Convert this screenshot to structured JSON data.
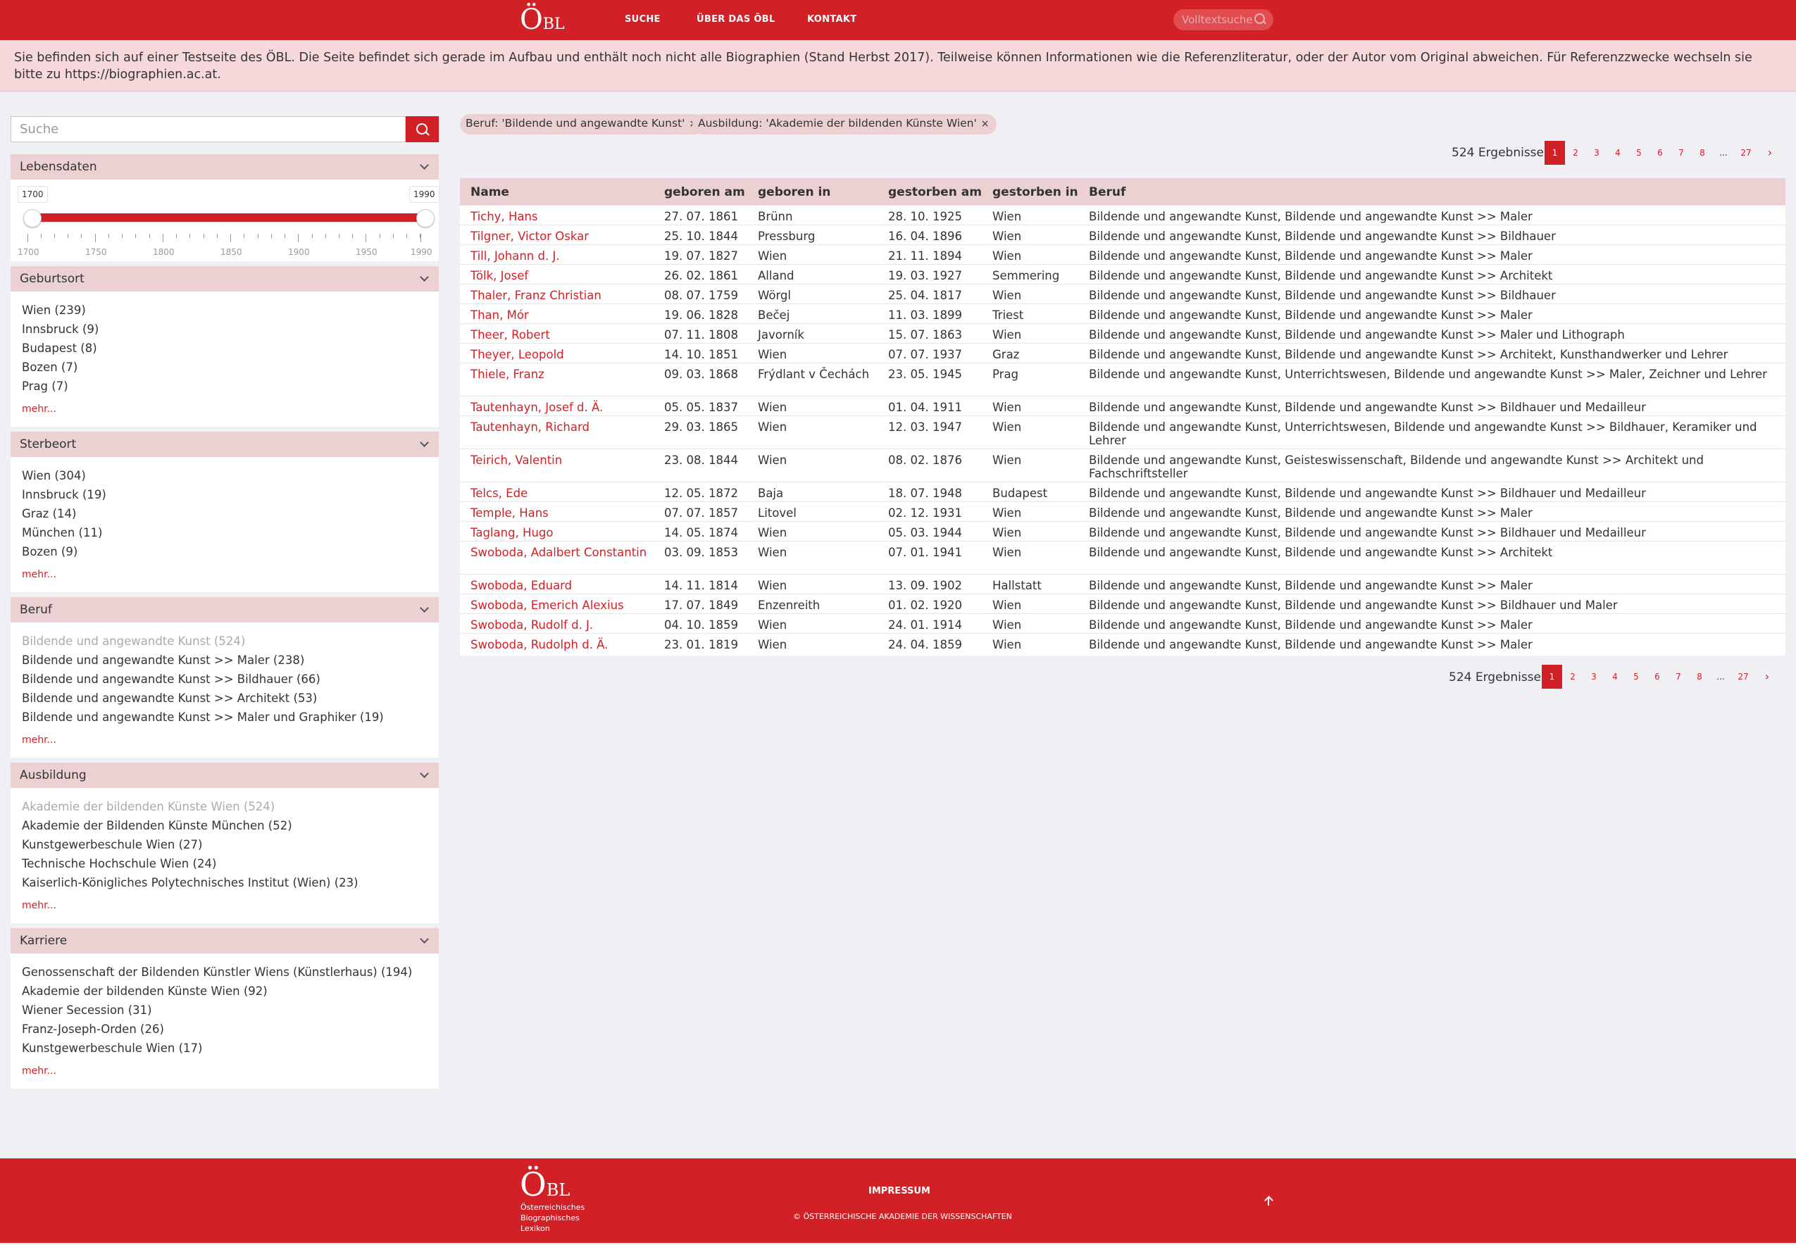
{
  "header": {
    "logo_big": "Ö",
    "logo_small": "BL",
    "nav": [
      "SUCHE",
      "ÜBER DAS ÖBL",
      "KONTAKT"
    ],
    "fulltext_placeholder": "Volltextsuche"
  },
  "notice": "Sie befinden sich auf einer Testseite des ÖBL. Die Seite befindet sich gerade im Aufbau und enthält noch nicht alle Biographien (Stand Herbst 2017). Teilweise können Informationen wie die Referenzliteratur, oder der Autor vom Original abweichen. Für Referenzzwecke wechseln sie bitte zu https://biographien.ac.at.",
  "sidebar": {
    "search_placeholder": "Suche",
    "lebensdaten": {
      "title": "Lebensdaten",
      "min": "1700",
      "max": "1990",
      "ticks": [
        "1700",
        "1750",
        "1800",
        "1850",
        "1900",
        "1950",
        "1990"
      ]
    },
    "panels": [
      {
        "title": "Geburtsort",
        "items": [
          "Wien (239)",
          "Innsbruck (9)",
          "Budapest (8)",
          "Bozen (7)",
          "Prag (7)"
        ],
        "more": "mehr..."
      },
      {
        "title": "Sterbeort",
        "items": [
          "Wien (304)",
          "Innsbruck (19)",
          "Graz (14)",
          "München (11)",
          "Bozen (9)"
        ],
        "more": "mehr..."
      },
      {
        "title": "Beruf",
        "items": [
          "Bildende und angewandte Kunst (524)",
          "Bildende und angewandte Kunst >> Maler (238)",
          "Bildende und angewandte Kunst >> Bildhauer (66)",
          "Bildende und angewandte Kunst >> Architekt (53)",
          "Bildende und angewandte Kunst >> Maler und Graphiker (19)"
        ],
        "more": "mehr..."
      },
      {
        "title": "Ausbildung",
        "items": [
          "Akademie der bildenden Künste Wien (524)",
          "Akademie der Bildenden Künste München (52)",
          "Kunstgewerbeschule Wien (27)",
          "Technische Hochschule Wien (24)",
          "Kaiserlich-Königliches Polytechnisches Institut (Wien) (23)"
        ],
        "more": "mehr..."
      },
      {
        "title": "Karriere",
        "items": [
          "Genossenschaft der Bildenden Künstler Wiens (Künstlerhaus) (194)",
          "Akademie der bildenden Künste Wien (92)",
          "Wiener Secession (31)",
          "Franz-Joseph-Orden (26)",
          "Kunstgewerbeschule Wien (17)"
        ],
        "more": "mehr..."
      }
    ]
  },
  "filters": [
    "Beruf: 'Bildende und angewandte Kunst'",
    "Ausbildung: 'Akademie der bildenden Künste Wien'"
  ],
  "filter_close": "×",
  "results": {
    "count": "524 Ergebnisse",
    "pages": [
      "1",
      "2",
      "3",
      "4",
      "5",
      "6",
      "7",
      "8",
      "...",
      "27",
      "›"
    ],
    "current_page": "1"
  },
  "table": {
    "headers": [
      "Name",
      "geboren am",
      "geboren in",
      "gestorben am",
      "gestorben in",
      "Beruf"
    ],
    "rows": [
      [
        "Tichy, Hans",
        "27. 07. 1861",
        "Brünn",
        "28. 10. 1925",
        "Wien",
        "Bildende und angewandte Kunst, Bildende und angewandte Kunst >> Maler"
      ],
      [
        "Tilgner, Victor Oskar",
        "25. 10. 1844",
        "Pressburg",
        "16. 04. 1896",
        "Wien",
        "Bildende und angewandte Kunst, Bildende und angewandte Kunst >> Bildhauer"
      ],
      [
        "Till, Johann d. J.",
        "19. 07. 1827",
        "Wien",
        "21. 11. 1894",
        "Wien",
        "Bildende und angewandte Kunst, Bildende und angewandte Kunst >> Maler"
      ],
      [
        "Tölk, Josef",
        "26. 02. 1861",
        "Alland",
        "19. 03. 1927",
        "Semmering",
        "Bildende und angewandte Kunst, Bildende und angewandte Kunst >> Architekt"
      ],
      [
        "Thaler, Franz Christian",
        "08. 07. 1759",
        "Wörgl",
        "25. 04. 1817",
        "Wien",
        "Bildende und angewandte Kunst, Bildende und angewandte Kunst >> Bildhauer"
      ],
      [
        "Than, Mór",
        "19. 06. 1828",
        "Bečej",
        "11. 03. 1899",
        "Triest",
        "Bildende und angewandte Kunst, Bildende und angewandte Kunst >> Maler"
      ],
      [
        "Theer, Robert",
        "07. 11. 1808",
        "Javorník",
        "15. 07. 1863",
        "Wien",
        "Bildende und angewandte Kunst, Bildende und angewandte Kunst >> Maler und Lithograph"
      ],
      [
        "Theyer, Leopold",
        "14. 10. 1851",
        "Wien",
        "07. 07. 1937",
        "Graz",
        "Bildende und angewandte Kunst, Bildende und angewandte Kunst >> Architekt, Kunsthandwerker und Lehrer"
      ],
      [
        "Thiele, Franz",
        "09. 03. 1868",
        "Frýdlant v Čechách",
        "23. 05. 1945",
        "Prag",
        "Bildende und angewandte Kunst, Unterrichtswesen, Bildende und angewandte Kunst >> Maler, Zeichner und Lehrer"
      ],
      [
        "Tautenhayn, Josef d. Ä.",
        "05. 05. 1837",
        "Wien",
        "01. 04. 1911",
        "Wien",
        "Bildende und angewandte Kunst, Bildende und angewandte Kunst >> Bildhauer und Medailleur"
      ],
      [
        "Tautenhayn, Richard",
        "29. 03. 1865",
        "Wien",
        "12. 03. 1947",
        "Wien",
        "Bildende und angewandte Kunst, Unterrichtswesen, Bildende und angewandte Kunst >> Bildhauer, Keramiker und Lehrer"
      ],
      [
        "Teirich, Valentin",
        "23. 08. 1844",
        "Wien",
        "08. 02. 1876",
        "Wien",
        "Bildende und angewandte Kunst, Geisteswissenschaft, Bildende und angewandte Kunst >> Architekt und Fachschriftsteller"
      ],
      [
        "Telcs, Ede",
        "12. 05. 1872",
        "Baja",
        "18. 07. 1948",
        "Budapest",
        "Bildende und angewandte Kunst, Bildende und angewandte Kunst >> Bildhauer und Medailleur"
      ],
      [
        "Temple, Hans",
        "07. 07. 1857",
        "Litovel",
        "02. 12. 1931",
        "Wien",
        "Bildende und angewandte Kunst, Bildende und angewandte Kunst >> Maler"
      ],
      [
        "Taglang, Hugo",
        "14. 05. 1874",
        "Wien",
        "05. 03. 1944",
        "Wien",
        "Bildende und angewandte Kunst, Bildende und angewandte Kunst >> Bildhauer und Medailleur"
      ],
      [
        "Swoboda, Adalbert Constantin",
        "03. 09. 1853",
        "Wien",
        "07. 01. 1941",
        "Wien",
        "Bildende und angewandte Kunst, Bildende und angewandte Kunst >> Architekt"
      ],
      [
        "Swoboda, Eduard",
        "14. 11. 1814",
        "Wien",
        "13. 09. 1902",
        "Hallstatt",
        "Bildende und angewandte Kunst, Bildende und angewandte Kunst >> Maler"
      ],
      [
        "Swoboda, Emerich Alexius",
        "17. 07. 1849",
        "Enzenreith",
        "01. 02. 1920",
        "Wien",
        "Bildende und angewandte Kunst, Bildende und angewandte Kunst >> Bildhauer und Maler"
      ],
      [
        "Swoboda, Rudolf d. J.",
        "04. 10. 1859",
        "Wien",
        "24. 01. 1914",
        "Wien",
        "Bildende und angewandte Kunst, Bildende und angewandte Kunst >> Maler"
      ],
      [
        "Swoboda, Rudolph d. Ä.",
        "23. 01. 1819",
        "Wien",
        "24. 04. 1859",
        "Wien",
        "Bildende und angewandte Kunst, Bildende und angewandte Kunst >> Maler"
      ]
    ]
  },
  "footer": {
    "logo_big": "Ö",
    "logo_small": "BL",
    "lines": [
      "Österreichisches",
      "Biographisches",
      "Lexikon"
    ],
    "impressum": "IMPRESSUM",
    "copyright": "© ÖSTERREICHISCHE AKADEMIE DER WISSENSCHAFTEN"
  },
  "colors": {
    "brand": "#d12127",
    "panel_head": "#ecd1d3",
    "notice_bg": "#f7d9dc"
  },
  "icons": [
    "search-icon",
    "chevron-down-icon",
    "close-icon",
    "arrow-up-icon"
  ]
}
